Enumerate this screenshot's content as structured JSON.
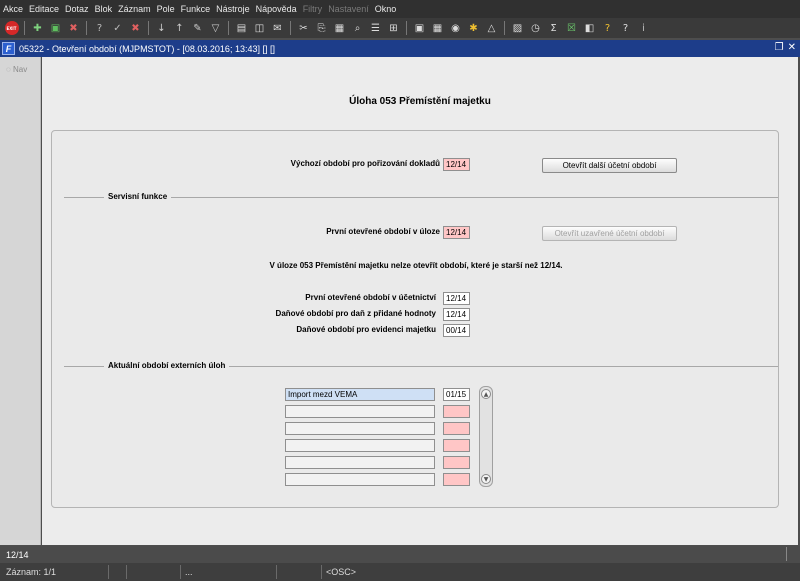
{
  "menu": [
    "Akce",
    "Editace",
    "Dotaz",
    "Blok",
    "Záznam",
    "Pole",
    "Funkce",
    "Nástroje",
    "Nápověda",
    "Filtry",
    "Nastavení",
    "Okno"
  ],
  "menu_disabled": [
    "Filtry",
    "Nastavení"
  ],
  "toolbar": {
    "exit_label": "EXIT",
    "icons": [
      "add-record-icon",
      "save-icon",
      "delete-record-icon",
      "query-icon",
      "query-exec-icon",
      "query-cancel-icon",
      "sort-asc-icon",
      "sort-desc-icon",
      "tools-icon",
      "filter-icon",
      "print-icon",
      "preview-icon",
      "mail-icon",
      "cut-icon",
      "copy-icon",
      "paste-icon",
      "find-icon",
      "list-icon",
      "tree-icon",
      "export-icon",
      "calc-icon",
      "globe-icon",
      "star-icon",
      "warning-icon",
      "image-icon",
      "clock-icon",
      "sum-icon",
      "excel-icon",
      "chart-icon",
      "help-icon",
      "about-icon",
      "info-icon"
    ]
  },
  "window": {
    "title": "05322 - Otevření období (MJPMSTOT) - [08.03.2016; 13:43] [] []",
    "nav_label": "Nav"
  },
  "form": {
    "title": "Úloha  053 Přemístění majetku",
    "source_period_label": "Výchozí období pro pořizování dokladů",
    "source_period_value": "12/14",
    "open_next_button": "Otevřít další účetní období",
    "service_section": "Servisní funkce",
    "first_open_task_label": "První otevřené období v úloze",
    "first_open_task_value": "12/14",
    "open_closed_button": "Otevřít uzavřené účetní období",
    "warning_message": "V úloze 053 Přemístění majetku nelze otevřít období, které je starší než 12/14.",
    "first_open_accounting_label": "První otevřené období v účetnictví",
    "first_open_accounting_value": "12/14",
    "vat_period_label": "Daňové období pro daň z přidané hodnoty",
    "vat_period_value": "12/14",
    "asset_period_label": "Daňové období pro evidenci majetku",
    "asset_period_value": "00/14",
    "external_section": "Aktuální období externích úloh",
    "external_rows": [
      {
        "name": "Import mezd VEMA",
        "period": "01/15"
      },
      {
        "name": "",
        "period": ""
      },
      {
        "name": "",
        "period": ""
      },
      {
        "name": "",
        "period": ""
      },
      {
        "name": "",
        "period": ""
      },
      {
        "name": "",
        "period": ""
      }
    ]
  },
  "status": {
    "value": "12/14",
    "record": "Záznam: 1/1",
    "ellipsis": "...",
    "osc": "<OSC>"
  }
}
